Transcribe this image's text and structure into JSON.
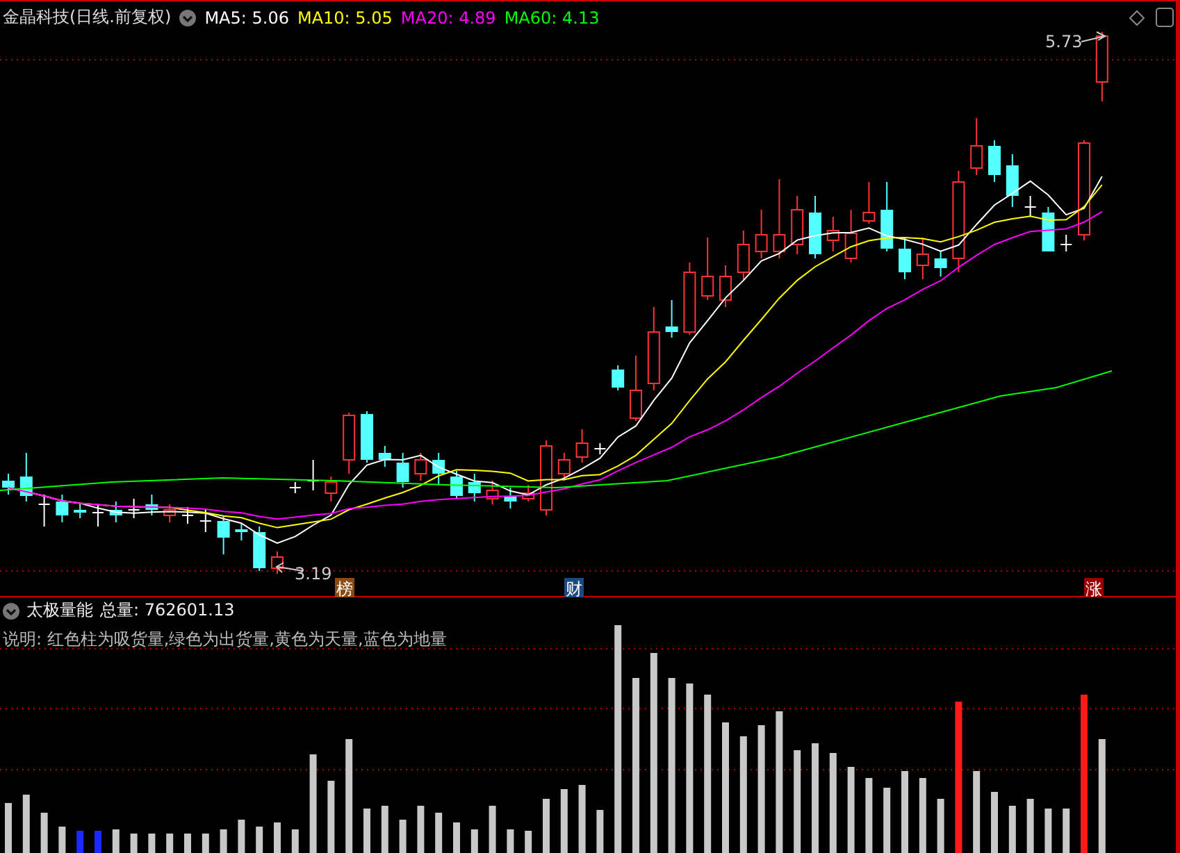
{
  "header": {
    "stock": "金晶科技(日线.前复权)",
    "ma": [
      {
        "label": "MA5: 5.06",
        "color": "#ffffff"
      },
      {
        "label": "MA10: 5.05",
        "color": "#ffff00"
      },
      {
        "label": "MA20: 4.89",
        "color": "#ff00ff"
      },
      {
        "label": "MA60: 4.13",
        "color": "#00ff00"
      }
    ]
  },
  "price_chart": {
    "high_label": "5.73",
    "low_label": "3.19",
    "markers": [
      {
        "text": "榜",
        "color": "#8b4a10"
      },
      {
        "text": "财",
        "color": "#1a4a80"
      },
      {
        "text": "涨",
        "color": "#9a0000"
      }
    ]
  },
  "indicator": {
    "name": "太极量能",
    "total": "总量: 762601.13",
    "description": "说明: 红色柱为吸货量,绿色为出货量,黄色为天量,蓝色为地量"
  }
}
